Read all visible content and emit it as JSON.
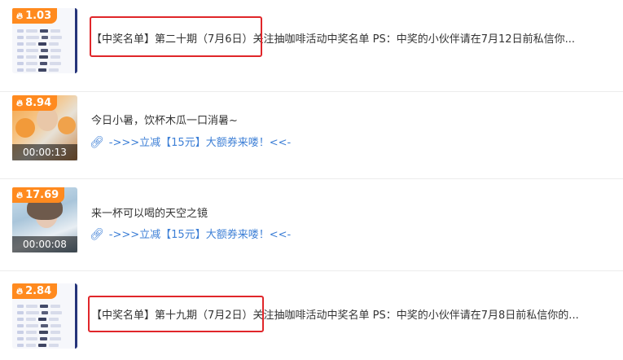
{
  "feed": {
    "items": [
      {
        "heat": "1.03",
        "title": "【中奖名单】第二十期（7月6日）关注抽咖啡活动中奖名单 PS：中奖的小伙伴请在7月12日前私信你..."
      },
      {
        "heat": "8.94",
        "duration": "00:00:13",
        "title": "今日小暑，饮杯木瓜一口消暑~",
        "promo": "->>>立减【15元】大额券来喽！<<-"
      },
      {
        "heat": "17.69",
        "duration": "00:00:08",
        "title": "来一杯可以喝的天空之镜",
        "promo": "->>>立减【15元】大额券来喽！<<-"
      },
      {
        "heat": "2.84",
        "title": "【中奖名单】第十九期（7月2日）关注抽咖啡活动中奖名单 PS：中奖的小伙伴请在7月8日前私信你的..."
      }
    ]
  },
  "icons": {
    "flame": "flame-icon",
    "link": "link-icon"
  },
  "colors": {
    "badge": "#ff8a1f",
    "link": "#3d7fd6",
    "highlight_box": "#e0262a"
  }
}
